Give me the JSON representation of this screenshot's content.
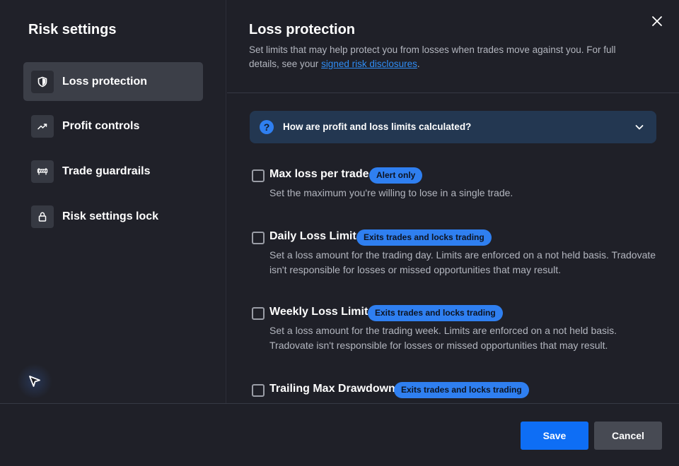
{
  "sidebar": {
    "title": "Risk settings",
    "items": [
      {
        "label": "Loss protection",
        "icon": "shield-icon",
        "active": true
      },
      {
        "label": "Profit controls",
        "icon": "trending-up-icon",
        "active": false
      },
      {
        "label": "Trade guardrails",
        "icon": "barrier-icon",
        "active": false
      },
      {
        "label": "Risk settings lock",
        "icon": "lock-icon",
        "active": false
      }
    ]
  },
  "main": {
    "title": "Loss protection",
    "subtitle_prefix": "Set limits that may help protect you from losses when trades move against you. For full details, see your ",
    "subtitle_link": "signed risk disclosures",
    "subtitle_suffix": ".",
    "info_panel": {
      "label": "How are profit and loss limits calculated?",
      "icon": "question-icon",
      "expanded": false
    },
    "settings": [
      {
        "title": "Max loss per trade",
        "badge": "Alert only",
        "description": "Set the maximum you're willing to lose in a single trade.",
        "checked": false
      },
      {
        "title": "Daily Loss Limit",
        "badge": "Exits trades and locks trading",
        "description": "Set a loss amount for the trading day. Limits are enforced on a not held basis. Tradovate isn't responsible for losses or missed opportunities that may result.",
        "checked": false
      },
      {
        "title": "Weekly Loss Limit",
        "badge": "Exits trades and locks trading",
        "description": "Set a loss amount for the trading week. Limits are enforced on a not held basis. Tradovate isn't responsible for losses or missed opportunities that may result.",
        "checked": false
      },
      {
        "title": "Trailing Max Drawdown",
        "badge": "Exits trades and locks trading",
        "description": "",
        "checked": false
      }
    ]
  },
  "footer": {
    "save_label": "Save",
    "cancel_label": "Cancel"
  },
  "colors": {
    "accent": "#0e6ef5",
    "badge": "#2f7ff0",
    "link": "#2f8df5",
    "background": "#1f2028",
    "info_panel": "#233751"
  }
}
